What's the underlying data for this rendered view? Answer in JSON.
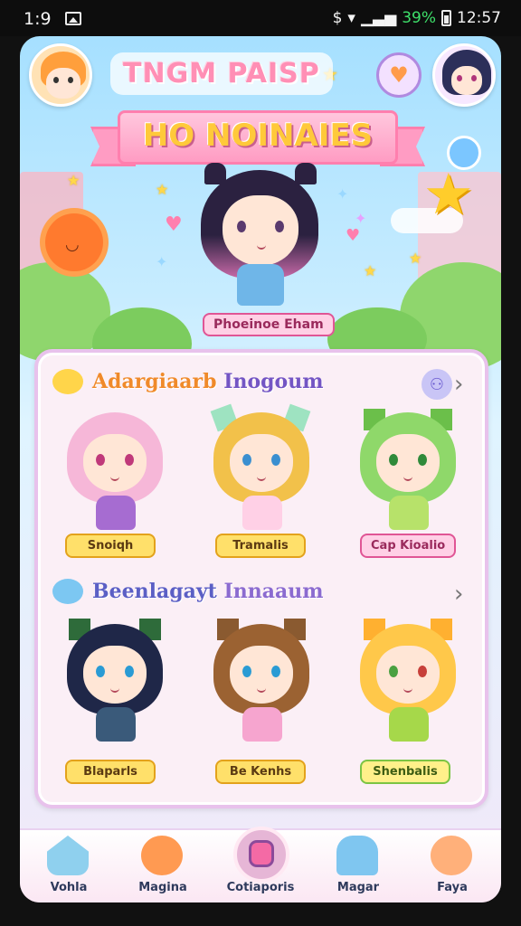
{
  "status_bar": {
    "time": "1:9",
    "battery_percent": "39%",
    "clock": "12:57"
  },
  "header": {
    "app_title": "TNGM PAISP",
    "banner_title": "HO NOINAIES",
    "featured_name": "Phoeinoe Eham"
  },
  "sections": [
    {
      "title_part1": "Adargiaarb",
      "title_part2": "Inogoum",
      "characters": [
        {
          "name": "Snoiqh"
        },
        {
          "name": "Tramalis"
        },
        {
          "name": "Cap Kioalio"
        }
      ]
    },
    {
      "title_part1": "Beenlagayt",
      "title_part2": "Innaaum",
      "characters": [
        {
          "name": "Blaparls"
        },
        {
          "name": "Be Kenhs"
        },
        {
          "name": "Shenbalis"
        }
      ]
    }
  ],
  "nav": [
    {
      "label": "Vohla",
      "icon": "home-icon"
    },
    {
      "label": "Magina",
      "icon": "bear-icon"
    },
    {
      "label": "Cotiaporis",
      "icon": "stack-icon"
    },
    {
      "label": "Magar",
      "icon": "chat-icon"
    },
    {
      "label": "Faya",
      "icon": "creature-icon"
    }
  ],
  "colors": {
    "accent_pink": "#ff8fb5",
    "accent_orange": "#f08a2a",
    "accent_purple": "#7355c4",
    "tag_yellow": "#ffe06a"
  }
}
